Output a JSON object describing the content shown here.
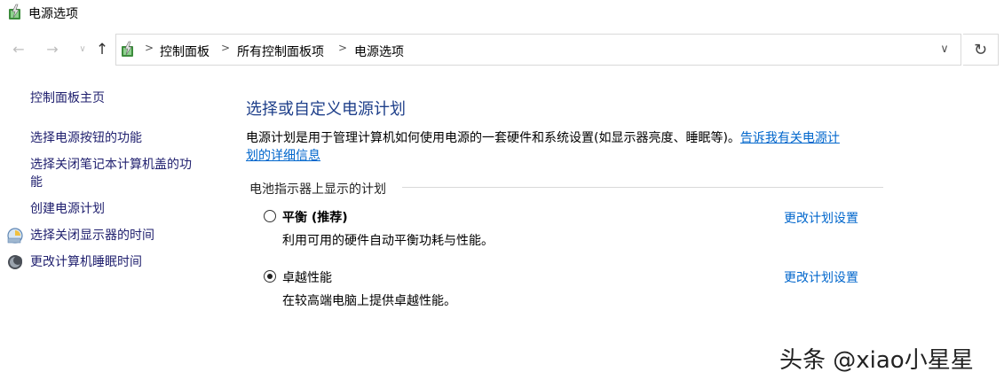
{
  "window": {
    "title": "电源选项"
  },
  "nav": {
    "back_icon": "←",
    "forward_icon": "→",
    "recent_icon": "∨",
    "up_icon": "↑",
    "refresh_icon": "↻",
    "dropdown_icon": "∨"
  },
  "address": {
    "crumbs": [
      "控制面板",
      "所有控制面板项",
      "电源选项"
    ],
    "separator": ">"
  },
  "sidebar": {
    "home": "控制面板主页",
    "links": [
      "选择电源按钮的功能",
      "选择关闭笔记本计算机盖的功\n能",
      "创建电源计划",
      "选择关闭显示器的时间",
      "更改计算机睡眠时间"
    ]
  },
  "main": {
    "title": "选择或自定义电源计划",
    "description": "电源计划是用于管理计算机如何使用电源的一套硬件和系统设置(如显示器亮度、睡眠等)。",
    "description_link_1": "告诉我有关电源计",
    "description_link_2": "划的详细信息",
    "group_label": "电池指示器上显示的计划",
    "plans": [
      {
        "name": "平衡 (推荐)",
        "description": "利用可用的硬件自动平衡功耗与性能。",
        "link": "更改计划设置",
        "selected": false
      },
      {
        "name": "卓越性能",
        "description": "在较高端电脑上提供卓越性能。",
        "link": "更改计划设置",
        "selected": true
      }
    ]
  },
  "watermark": "头条 @xiao小星星",
  "colors": {
    "title_blue": "#1e3f8a",
    "link_blue": "#0066cc",
    "sidebar_link": "#1f1f6e"
  }
}
